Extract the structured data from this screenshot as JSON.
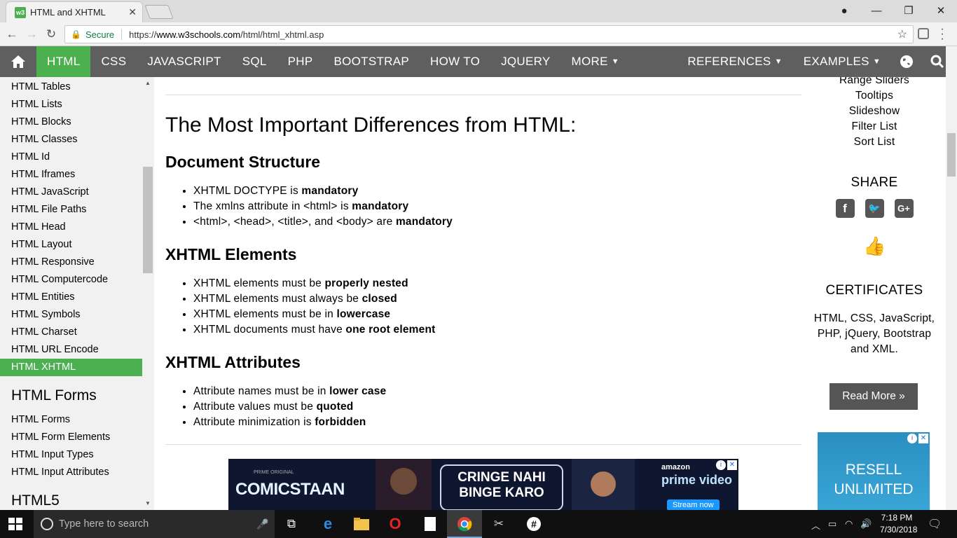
{
  "browser": {
    "tab_title": "HTML and XHTML",
    "tab_favicon": "w3",
    "secure_label": "Secure",
    "url_scheme": "https://",
    "url_domain": "www.w3schools.com",
    "url_path": "/html/html_xhtml.asp"
  },
  "topnav": {
    "items": [
      "HTML",
      "CSS",
      "JAVASCRIPT",
      "SQL",
      "PHP",
      "BOOTSTRAP",
      "HOW TO",
      "JQUERY",
      "MORE"
    ],
    "right": [
      "REFERENCES",
      "EXAMPLES"
    ],
    "active": "HTML",
    "accent": "#4caf50",
    "bar_color": "#5f5f5f"
  },
  "sidebar": {
    "items": [
      "HTML Tables",
      "HTML Lists",
      "HTML Blocks",
      "HTML Classes",
      "HTML Id",
      "HTML Iframes",
      "HTML JavaScript",
      "HTML File Paths",
      "HTML Head",
      "HTML Layout",
      "HTML Responsive",
      "HTML Computercode",
      "HTML Entities",
      "HTML Symbols",
      "HTML Charset",
      "HTML URL Encode",
      "HTML XHTML"
    ],
    "active": "HTML XHTML",
    "forms_heading": "HTML Forms",
    "forms_items": [
      "HTML Forms",
      "HTML Form Elements",
      "HTML Input Types",
      "HTML Input Attributes"
    ],
    "next_heading": "HTML5"
  },
  "main": {
    "title": "The Most Important Differences from HTML:",
    "sections": [
      {
        "heading": "Document Structure",
        "items": [
          {
            "text": "XHTML DOCTYPE is ",
            "bold": "mandatory"
          },
          {
            "text": "The xmlns attribute in <html> is ",
            "bold": "mandatory"
          },
          {
            "text": "<html>, <head>, <title>, and <body> are ",
            "bold": "mandatory"
          }
        ]
      },
      {
        "heading": "XHTML Elements",
        "items": [
          {
            "text": "XHTML elements must be ",
            "bold": "properly nested"
          },
          {
            "text": "XHTML elements must always be ",
            "bold": "closed"
          },
          {
            "text": "XHTML elements must be in ",
            "bold": "lowercase"
          },
          {
            "text": "XHTML documents must have ",
            "bold": "one root element"
          }
        ]
      },
      {
        "heading": "XHTML Attributes",
        "items": [
          {
            "text": "Attribute names must be in ",
            "bold": "lower case"
          },
          {
            "text": "Attribute values must be ",
            "bold": "quoted"
          },
          {
            "text": "Attribute minimization is ",
            "bold": "forbidden"
          }
        ]
      }
    ],
    "ad": {
      "small": "PRIME ORIGINAL",
      "brand": "COMICSTAAN",
      "line1": "CRINGE NAHI",
      "line2": "BINGE KARO",
      "amazon": "amazon",
      "prime": "prime video",
      "cta": "Stream now"
    }
  },
  "right": {
    "links": [
      "Range Sliders",
      "Tooltips",
      "Slideshow",
      "Filter List",
      "Sort List"
    ],
    "share_heading": "SHARE",
    "social_icons": [
      "facebook-icon",
      "twitter-icon",
      "google-plus-icon"
    ],
    "cert_heading": "CERTIFICATES",
    "cert_text": "HTML, CSS, JavaScript, PHP, jQuery, Bootstrap and XML.",
    "read_more": "Read More »",
    "ad_line1": "RESELL",
    "ad_line2": "UNLIMITED"
  },
  "taskbar": {
    "search_placeholder": "Type here to search",
    "time": "7:18 PM",
    "date": "7/30/2018"
  }
}
